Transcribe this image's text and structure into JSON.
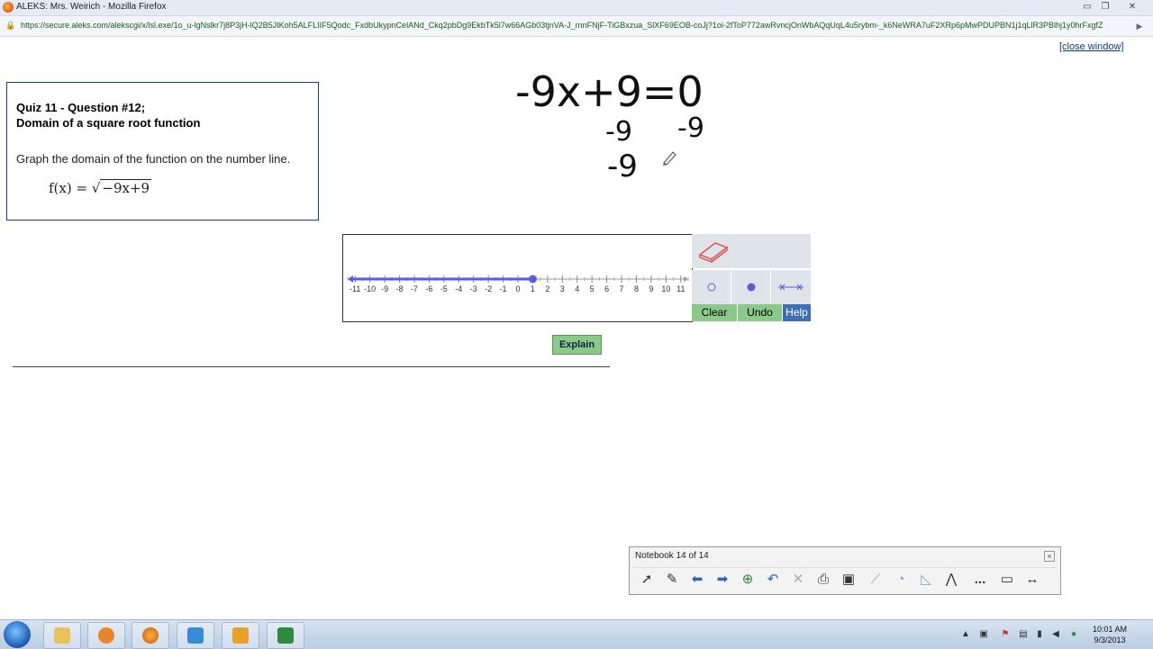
{
  "browser": {
    "window_title": "ALEKS: Mrs. Weirich - Mozilla Firefox",
    "url": "https://secure.aleks.com/alekscgi/x/lsl.exe/1o_u-lgNslkr7j8P3jH-lQ2B5JIKoh5ALFLIIF5Qodc_FxdbUkypnCelANd_Ckq2pbDg9EkbTk5l7w66AGb03tjnVA-J_rnnFNjF-TiGBxzua_SlXF69EOB-coJj?1oi-2fToP772awRvncjOnWbAQqUqL4u5rybm-_k6NeWRA7uF2XRp6pMwPDUPBN1j1qLlR3PBlhj1y0hrFxgfZ",
    "controls": {
      "minimize": "▭",
      "restore": "❐",
      "close": "✕"
    }
  },
  "page": {
    "close_window": "[close window]",
    "question": {
      "title_line1": "Quiz 11 - Question #12;",
      "title_line2": "Domain of a square root function",
      "instruction": "Graph the domain of the function on the number line.",
      "formula_lhs": "f(x) =",
      "formula_radicand": "−9x+9"
    },
    "handwriting": {
      "line1": "-9x+9=0",
      "line2_left": "-9",
      "line2_right": "-9",
      "line3": "-9"
    },
    "number_line": {
      "ticks": [
        -11,
        -10,
        -9,
        -8,
        -7,
        -6,
        -5,
        -4,
        -3,
        -2,
        -1,
        0,
        1,
        2,
        3,
        4,
        5,
        6,
        7,
        8,
        9,
        10,
        11
      ],
      "min": -11.5,
      "max": 11.5,
      "shaded_from": -11.5,
      "shaded_to": 1,
      "endpoint": 1,
      "endpoint_closed": true,
      "accent": "#5b5ce6"
    },
    "tools": {
      "clear": "Clear",
      "undo": "Undo",
      "help": "Help"
    },
    "explain": "Explain"
  },
  "notebook": {
    "title": "Notebook 14 of 14",
    "close": "×",
    "more": "..."
  },
  "taskbar": {
    "time": "10:01 AM",
    "date": "9/3/2013"
  }
}
